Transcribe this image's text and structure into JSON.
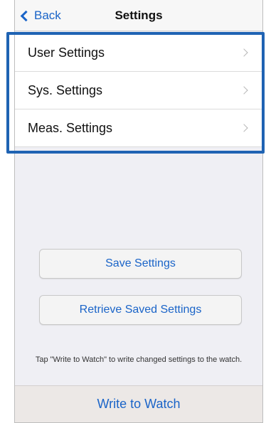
{
  "nav": {
    "back_label": "Back",
    "title": "Settings"
  },
  "settings_list": {
    "items": [
      {
        "label": "User Settings"
      },
      {
        "label": "Sys. Settings"
      },
      {
        "label": "Meas. Settings"
      }
    ]
  },
  "buttons": {
    "save_label": "Save Settings",
    "retrieve_label": "Retrieve Saved Settings"
  },
  "hint_text": "Tap \"Write to Watch\" to write changed settings to the watch.",
  "footer": {
    "write_label": "Write to Watch"
  },
  "colors": {
    "accent": "#1a64c8",
    "highlight_border": "#1f63b3",
    "background": "#efeff4"
  }
}
